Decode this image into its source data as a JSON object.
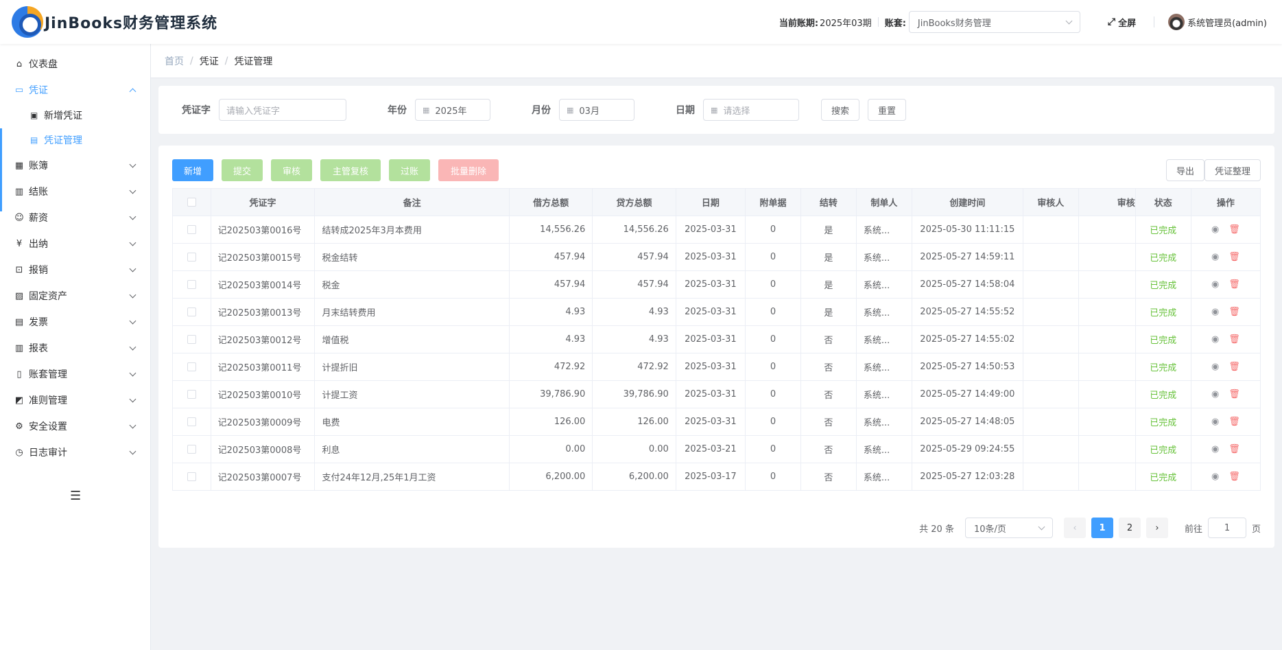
{
  "app": {
    "title": "JinBooks财务管理系统"
  },
  "header": {
    "period_label": "当前账期:",
    "period_value": "2025年03期",
    "book_label": "账套:",
    "book_value": "JinBooks财务管理",
    "fullscreen_label": "全屏",
    "user_name": "系统管理员(admin)"
  },
  "sidebar": {
    "items": [
      {
        "label": "仪表盘",
        "icon": "home-icon"
      },
      {
        "label": "凭证",
        "icon": "voucher-icon",
        "open": true
      },
      {
        "label": "账簿",
        "icon": "ledger-icon"
      },
      {
        "label": "结账",
        "icon": "closing-icon"
      },
      {
        "label": "薪资",
        "icon": "user-icon"
      },
      {
        "label": "出纳",
        "icon": "cashier-icon"
      },
      {
        "label": "报销",
        "icon": "reimburse-icon"
      },
      {
        "label": "固定资产",
        "icon": "calendar-icon"
      },
      {
        "label": "发票",
        "icon": "invoice-icon"
      },
      {
        "label": "报表",
        "icon": "chart-icon"
      },
      {
        "label": "账套管理",
        "icon": "book-icon"
      },
      {
        "label": "准则管理",
        "icon": "rule-icon"
      },
      {
        "label": "安全设置",
        "icon": "gear-icon"
      },
      {
        "label": "日志审计",
        "icon": "clock-icon"
      }
    ],
    "sub_items": [
      {
        "label": "新增凭证"
      },
      {
        "label": "凭证管理",
        "active": true
      }
    ]
  },
  "breadcrumb": {
    "home": "首页",
    "section": "凭证",
    "page": "凭证管理"
  },
  "search": {
    "voucher_label": "凭证字",
    "voucher_placeholder": "请输入凭证字",
    "year_label": "年份",
    "year_value": "2025年",
    "month_label": "月份",
    "month_value": "03月",
    "date_label": "日期",
    "date_placeholder": "请选择",
    "search_button": "搜索",
    "reset_button": "重置"
  },
  "toolbar": {
    "add": "新增",
    "submit": "提交",
    "audit": "审核",
    "supervisor_review": "主管复核",
    "post": "过账",
    "batch_delete": "批量删除",
    "export": "导出",
    "organize": "凭证整理"
  },
  "table": {
    "headers": [
      "凭证字",
      "备注",
      "借方总额",
      "贷方总额",
      "日期",
      "附单据",
      "结转",
      "制单人",
      "创建时间",
      "审核人",
      "审核",
      "状态",
      "操作"
    ],
    "rows": [
      {
        "voucher": "记202503第0016号",
        "remark": "结转成2025年3月本费用",
        "debit": "14,556.26",
        "credit": "14,556.26",
        "date": "2025-03-31",
        "attach": "0",
        "carry": "是",
        "maker": "系统...",
        "created": "2025-05-30 11:11:15",
        "auditor": "",
        "audit": "",
        "status": "已完成"
      },
      {
        "voucher": "记202503第0015号",
        "remark": "税金结转",
        "debit": "457.94",
        "credit": "457.94",
        "date": "2025-03-31",
        "attach": "0",
        "carry": "是",
        "maker": "系统...",
        "created": "2025-05-27 14:59:11",
        "auditor": "",
        "audit": "",
        "status": "已完成"
      },
      {
        "voucher": "记202503第0014号",
        "remark": "税金",
        "debit": "457.94",
        "credit": "457.94",
        "date": "2025-03-31",
        "attach": "0",
        "carry": "是",
        "maker": "系统...",
        "created": "2025-05-27 14:58:04",
        "auditor": "",
        "audit": "",
        "status": "已完成"
      },
      {
        "voucher": "记202503第0013号",
        "remark": "月末结转费用",
        "debit": "4.93",
        "credit": "4.93",
        "date": "2025-03-31",
        "attach": "0",
        "carry": "是",
        "maker": "系统...",
        "created": "2025-05-27 14:55:52",
        "auditor": "",
        "audit": "",
        "status": "已完成"
      },
      {
        "voucher": "记202503第0012号",
        "remark": "增值税",
        "debit": "4.93",
        "credit": "4.93",
        "date": "2025-03-31",
        "attach": "0",
        "carry": "否",
        "maker": "系统...",
        "created": "2025-05-27 14:55:02",
        "auditor": "",
        "audit": "",
        "status": "已完成"
      },
      {
        "voucher": "记202503第0011号",
        "remark": "计提折旧",
        "debit": "472.92",
        "credit": "472.92",
        "date": "2025-03-31",
        "attach": "0",
        "carry": "否",
        "maker": "系统...",
        "created": "2025-05-27 14:50:53",
        "auditor": "",
        "audit": "",
        "status": "已完成"
      },
      {
        "voucher": "记202503第0010号",
        "remark": "计提工资",
        "debit": "39,786.90",
        "credit": "39,786.90",
        "date": "2025-03-31",
        "attach": "0",
        "carry": "否",
        "maker": "系统...",
        "created": "2025-05-27 14:49:00",
        "auditor": "",
        "audit": "",
        "status": "已完成"
      },
      {
        "voucher": "记202503第0009号",
        "remark": "电费",
        "debit": "126.00",
        "credit": "126.00",
        "date": "2025-03-31",
        "attach": "0",
        "carry": "否",
        "maker": "系统...",
        "created": "2025-05-27 14:48:05",
        "auditor": "",
        "audit": "",
        "status": "已完成"
      },
      {
        "voucher": "记202503第0008号",
        "remark": "利息",
        "debit": "0.00",
        "credit": "0.00",
        "date": "2025-03-21",
        "attach": "0",
        "carry": "否",
        "maker": "系统...",
        "created": "2025-05-29 09:24:55",
        "auditor": "",
        "audit": "",
        "status": "已完成"
      },
      {
        "voucher": "记202503第0007号",
        "remark": "支付24年12月,25年1月工资",
        "debit": "6,200.00",
        "credit": "6,200.00",
        "date": "2025-03-17",
        "attach": "0",
        "carry": "否",
        "maker": "系统...",
        "created": "2025-05-27 12:03:28",
        "auditor": "",
        "audit": "",
        "status": "已完成"
      }
    ]
  },
  "pagination": {
    "total": "共 20 条",
    "page_size": "10条/页",
    "pages": [
      "1",
      "2"
    ],
    "current": "1",
    "goto_label": "前往",
    "goto_value": "1",
    "page_suffix": "页"
  },
  "colors": {
    "primary": "#409eff",
    "success": "#67c23a",
    "danger": "#f56c6c"
  }
}
